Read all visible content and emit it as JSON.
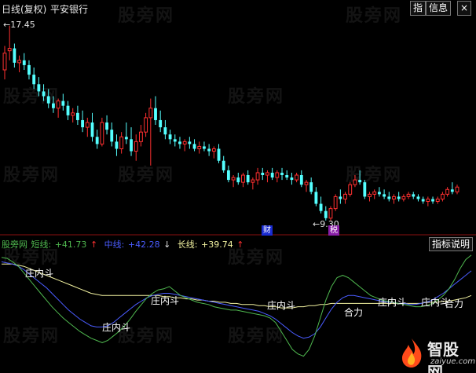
{
  "header": {
    "period_label": "日线(复权)",
    "stock_name": "平安银行",
    "btn_indicator": "指",
    "btn_info": "信息",
    "btn_close": "×"
  },
  "price_panel": {
    "high_label": "17.45",
    "low_label": "9.30",
    "badge_cai": "财",
    "badge_qi": "税"
  },
  "indicator_panel": {
    "name": "股旁网",
    "short_label": "短线:",
    "short_value": "+41.73",
    "short_arrow": "↑",
    "mid_label": "中线:",
    "mid_value": "+42.28",
    "mid_arrow": "↓",
    "long_label": "长线:",
    "long_value": "+39.74",
    "long_arrow": "↑",
    "explain_button": "指标说明",
    "annotations": [
      "庄内斗",
      "庄内斗",
      "庄内斗",
      "庄内斗",
      "合力",
      "庄内斗",
      "庄内斗",
      "合力"
    ]
  },
  "watermark": "股旁网",
  "logo": {
    "name": "智股网",
    "url": "zaiyue.com"
  },
  "colors": {
    "up": "#ff3030",
    "down": "#54ffff",
    "short_line": "#4fb84f",
    "mid_line": "#4a5cff",
    "long_line": "#f2f2a0"
  },
  "chart_data": {
    "type": "candlestick",
    "ohlc": [
      [
        15.6,
        16.6,
        15.2,
        16.3
      ],
      [
        16.4,
        17.45,
        16.0,
        16.5
      ],
      [
        16.5,
        16.7,
        15.7,
        15.9
      ],
      [
        15.9,
        16.2,
        15.5,
        16.0
      ],
      [
        16.0,
        16.3,
        15.6,
        15.8
      ],
      [
        15.8,
        16.0,
        15.2,
        15.4
      ],
      [
        15.4,
        15.7,
        14.8,
        15.0
      ],
      [
        15.0,
        15.3,
        14.5,
        14.7
      ],
      [
        14.7,
        15.0,
        14.3,
        14.5
      ],
      [
        14.5,
        14.8,
        14.0,
        14.2
      ],
      [
        14.2,
        14.5,
        13.8,
        14.0
      ],
      [
        14.0,
        14.4,
        13.6,
        14.3
      ],
      [
        14.3,
        14.6,
        13.9,
        14.1
      ],
      [
        14.1,
        14.3,
        13.5,
        13.7
      ],
      [
        13.7,
        14.0,
        13.4,
        13.8
      ],
      [
        13.8,
        14.1,
        13.3,
        13.5
      ],
      [
        13.5,
        13.9,
        13.0,
        13.2
      ],
      [
        13.2,
        13.6,
        12.8,
        13.4
      ],
      [
        13.4,
        13.8,
        12.6,
        12.8
      ],
      [
        12.8,
        13.1,
        12.3,
        12.5
      ],
      [
        12.5,
        13.6,
        12.4,
        13.4
      ],
      [
        13.4,
        13.7,
        12.9,
        13.1
      ],
      [
        13.1,
        13.4,
        12.4,
        12.6
      ],
      [
        12.6,
        12.9,
        12.0,
        12.3
      ],
      [
        12.3,
        13.0,
        12.1,
        12.8
      ],
      [
        12.8,
        13.4,
        12.5,
        12.7
      ],
      [
        12.7,
        13.2,
        12.0,
        12.2
      ],
      [
        12.2,
        12.9,
        11.8,
        12.6
      ],
      [
        12.6,
        13.3,
        12.4,
        13.0
      ],
      [
        13.0,
        13.8,
        12.8,
        13.6
      ],
      [
        13.6,
        14.4,
        11.6,
        14.0
      ],
      [
        14.0,
        14.5,
        13.3,
        13.5
      ],
      [
        13.5,
        13.9,
        13.0,
        13.2
      ],
      [
        13.2,
        13.5,
        12.7,
        12.9
      ],
      [
        12.9,
        13.1,
        12.5,
        12.7
      ],
      [
        12.7,
        12.9,
        12.4,
        12.6
      ],
      [
        12.6,
        12.8,
        12.3,
        12.5
      ],
      [
        12.5,
        12.7,
        12.2,
        12.6
      ],
      [
        12.6,
        12.8,
        12.3,
        12.5
      ],
      [
        12.5,
        12.7,
        12.2,
        12.3
      ],
      [
        12.3,
        12.6,
        12.1,
        12.4
      ],
      [
        12.4,
        12.6,
        12.2,
        12.3
      ],
      [
        12.3,
        12.5,
        12.0,
        12.2
      ],
      [
        12.2,
        12.4,
        11.9,
        12.3
      ],
      [
        12.3,
        12.5,
        11.7,
        11.8
      ],
      [
        11.8,
        12.0,
        11.3,
        11.4
      ],
      [
        11.4,
        11.6,
        10.9,
        11.0
      ],
      [
        11.0,
        11.2,
        10.7,
        11.1
      ],
      [
        11.1,
        11.3,
        10.8,
        10.9
      ],
      [
        10.9,
        11.3,
        10.7,
        11.2
      ],
      [
        11.2,
        11.4,
        10.8,
        10.9
      ],
      [
        10.9,
        11.1,
        10.6,
        11.0
      ],
      [
        11.0,
        11.5,
        10.8,
        11.3
      ],
      [
        11.3,
        11.5,
        11.0,
        11.2
      ],
      [
        11.2,
        11.4,
        10.9,
        11.3
      ],
      [
        11.3,
        11.5,
        11.0,
        11.1
      ],
      [
        11.1,
        11.4,
        10.9,
        11.3
      ],
      [
        11.3,
        11.5,
        11.0,
        11.2
      ],
      [
        11.2,
        11.4,
        11.0,
        11.1
      ],
      [
        11.1,
        11.3,
        10.8,
        11.0
      ],
      [
        11.0,
        11.3,
        10.9,
        11.2
      ],
      [
        11.2,
        11.4,
        10.7,
        10.8
      ],
      [
        10.8,
        11.0,
        10.5,
        10.9
      ],
      [
        10.9,
        11.1,
        10.4,
        10.5
      ],
      [
        10.5,
        10.7,
        9.9,
        10.0
      ],
      [
        10.0,
        10.3,
        9.6,
        9.7
      ],
      [
        9.7,
        9.9,
        9.3,
        9.4
      ],
      [
        9.4,
        9.9,
        9.3,
        9.8
      ],
      [
        9.8,
        10.4,
        9.7,
        10.3
      ],
      [
        10.3,
        10.6,
        10.0,
        10.2
      ],
      [
        10.2,
        10.5,
        10.0,
        10.4
      ],
      [
        10.4,
        10.9,
        10.3,
        10.8
      ],
      [
        10.8,
        11.2,
        10.7,
        11.0
      ],
      [
        11.0,
        11.4,
        10.8,
        10.9
      ],
      [
        10.9,
        11.0,
        10.2,
        10.3
      ],
      [
        10.3,
        10.5,
        10.1,
        10.4
      ],
      [
        10.4,
        10.6,
        10.2,
        10.5
      ],
      [
        10.5,
        10.7,
        10.3,
        10.4
      ],
      [
        10.4,
        10.6,
        10.2,
        10.3
      ],
      [
        10.3,
        10.5,
        10.1,
        10.2
      ],
      [
        10.2,
        10.4,
        10.0,
        10.3
      ],
      [
        10.3,
        10.5,
        10.1,
        10.2
      ],
      [
        10.2,
        10.4,
        10.1,
        10.3
      ],
      [
        10.3,
        10.5,
        10.2,
        10.4
      ],
      [
        10.4,
        10.5,
        10.2,
        10.3
      ],
      [
        10.3,
        10.4,
        10.1,
        10.2
      ],
      [
        10.2,
        10.3,
        10.0,
        10.1
      ],
      [
        10.1,
        10.3,
        9.9,
        10.2
      ],
      [
        10.2,
        10.3,
        10.0,
        10.1
      ],
      [
        10.1,
        10.3,
        10.0,
        10.2
      ],
      [
        10.2,
        10.5,
        10.1,
        10.4
      ],
      [
        10.4,
        10.7,
        10.3,
        10.6
      ],
      [
        10.6,
        10.9,
        10.4,
        10.5
      ],
      [
        10.5,
        10.8,
        10.4,
        10.7
      ]
    ],
    "price_range": [
      9.0,
      17.8
    ],
    "indicator": {
      "range": [
        0,
        100
      ],
      "short": [
        96,
        95,
        92,
        88,
        82,
        76,
        70,
        64,
        58,
        52,
        47,
        42,
        38,
        34,
        30,
        27,
        24,
        22,
        20,
        22,
        26,
        30,
        35,
        41,
        48,
        54,
        60,
        64,
        67,
        68,
        70,
        66,
        62,
        60,
        58,
        56,
        55,
        54,
        52,
        51,
        50,
        49,
        49,
        48,
        47,
        46,
        45,
        44,
        42,
        38,
        30,
        22,
        14,
        10,
        8,
        14,
        26,
        42,
        58,
        70,
        78,
        80,
        78,
        74,
        70,
        66,
        62,
        60,
        58,
        57,
        56,
        55,
        54,
        53,
        52,
        52,
        53,
        55,
        58,
        62,
        68,
        76,
        86,
        94,
        98
      ],
      "mid": [
        92,
        91,
        90,
        88,
        85,
        81,
        77,
        73,
        69,
        64,
        59,
        54,
        49,
        45,
        41,
        38,
        35,
        34,
        34,
        35,
        38,
        42,
        46,
        50,
        54,
        57,
        60,
        62,
        63,
        64,
        64,
        63,
        62,
        61,
        60,
        59,
        58,
        57,
        56,
        55,
        54,
        53,
        52,
        51,
        50,
        49,
        48,
        46,
        44,
        41,
        37,
        33,
        29,
        26,
        24,
        25,
        28,
        34,
        42,
        50,
        56,
        60,
        62,
        62,
        61,
        60,
        59,
        58,
        57,
        56,
        56,
        55,
        55,
        54,
        54,
        55,
        56,
        58,
        61,
        64,
        68,
        72,
        76,
        80,
        84
      ],
      "long": [
        90,
        90,
        90,
        89,
        88,
        86,
        84,
        82,
        80,
        78,
        76,
        74,
        72,
        70,
        68,
        66,
        64,
        63,
        62,
        62,
        62,
        62,
        62,
        62,
        62,
        62,
        62,
        62,
        62,
        61,
        61,
        60,
        60,
        59,
        59,
        58,
        58,
        57,
        57,
        56,
        56,
        55,
        55,
        54,
        54,
        54,
        53,
        53,
        52,
        52,
        51,
        51,
        51,
        52,
        52,
        53,
        53,
        54,
        54,
        55,
        55,
        55,
        55,
        55,
        55,
        55,
        55,
        55,
        55,
        55,
        55,
        55,
        55,
        55,
        55,
        55,
        56,
        56,
        56,
        57,
        57,
        58,
        59,
        60,
        62
      ]
    }
  }
}
